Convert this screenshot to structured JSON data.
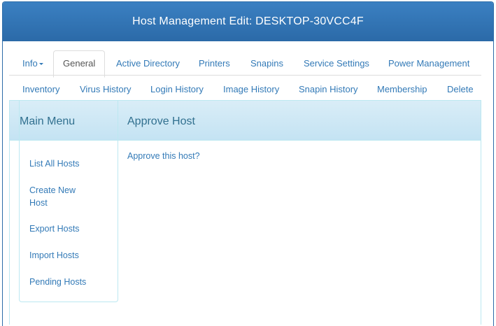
{
  "header": {
    "title": "Host Management Edit: DESKTOP-30VCC4F"
  },
  "tabs_row1": [
    {
      "label": "Info"
    },
    {
      "label": "General"
    },
    {
      "label": "Active Directory"
    },
    {
      "label": "Printers"
    },
    {
      "label": "Snapins"
    },
    {
      "label": "Service Settings"
    },
    {
      "label": "Power Management"
    }
  ],
  "tabs_row2": [
    {
      "label": "Inventory"
    },
    {
      "label": "Virus History"
    },
    {
      "label": "Login History"
    },
    {
      "label": "Image History"
    },
    {
      "label": "Snapin History"
    },
    {
      "label": "Membership"
    },
    {
      "label": "Delete"
    }
  ],
  "active_tab": "General",
  "sidebar": {
    "title": "Main Menu",
    "items": [
      {
        "label": "List All Hosts"
      },
      {
        "label": "Create New"
      },
      {
        "label": "Host"
      },
      {
        "label": "Export Hosts"
      },
      {
        "label": "Import Hosts"
      },
      {
        "label": "Pending Hosts"
      }
    ]
  },
  "main": {
    "title": "Approve Host",
    "approve_link": "Approve this host?"
  }
}
